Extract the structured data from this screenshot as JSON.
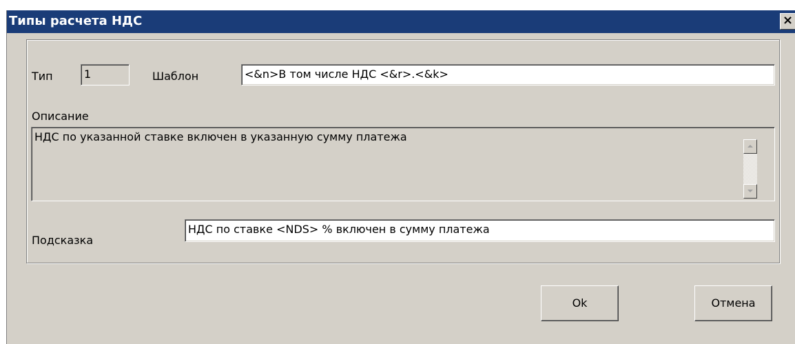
{
  "window": {
    "title": "Типы расчета НДС",
    "close_label": "×"
  },
  "form": {
    "type_label": "Тип",
    "type_value": "1",
    "template_label": "Шаблон",
    "template_value": "<&n>В том числе НДС <&r>.<&k>",
    "description_label": "Описание",
    "description_value": "НДС по указанной ставке включен в указанную сумму платежа",
    "hint_label": "Подсказка",
    "hint_value": "НДС по ставке <NDS> % включен в сумму платежа"
  },
  "buttons": {
    "ok_label": "Ok",
    "cancel_label": "Отмена"
  }
}
